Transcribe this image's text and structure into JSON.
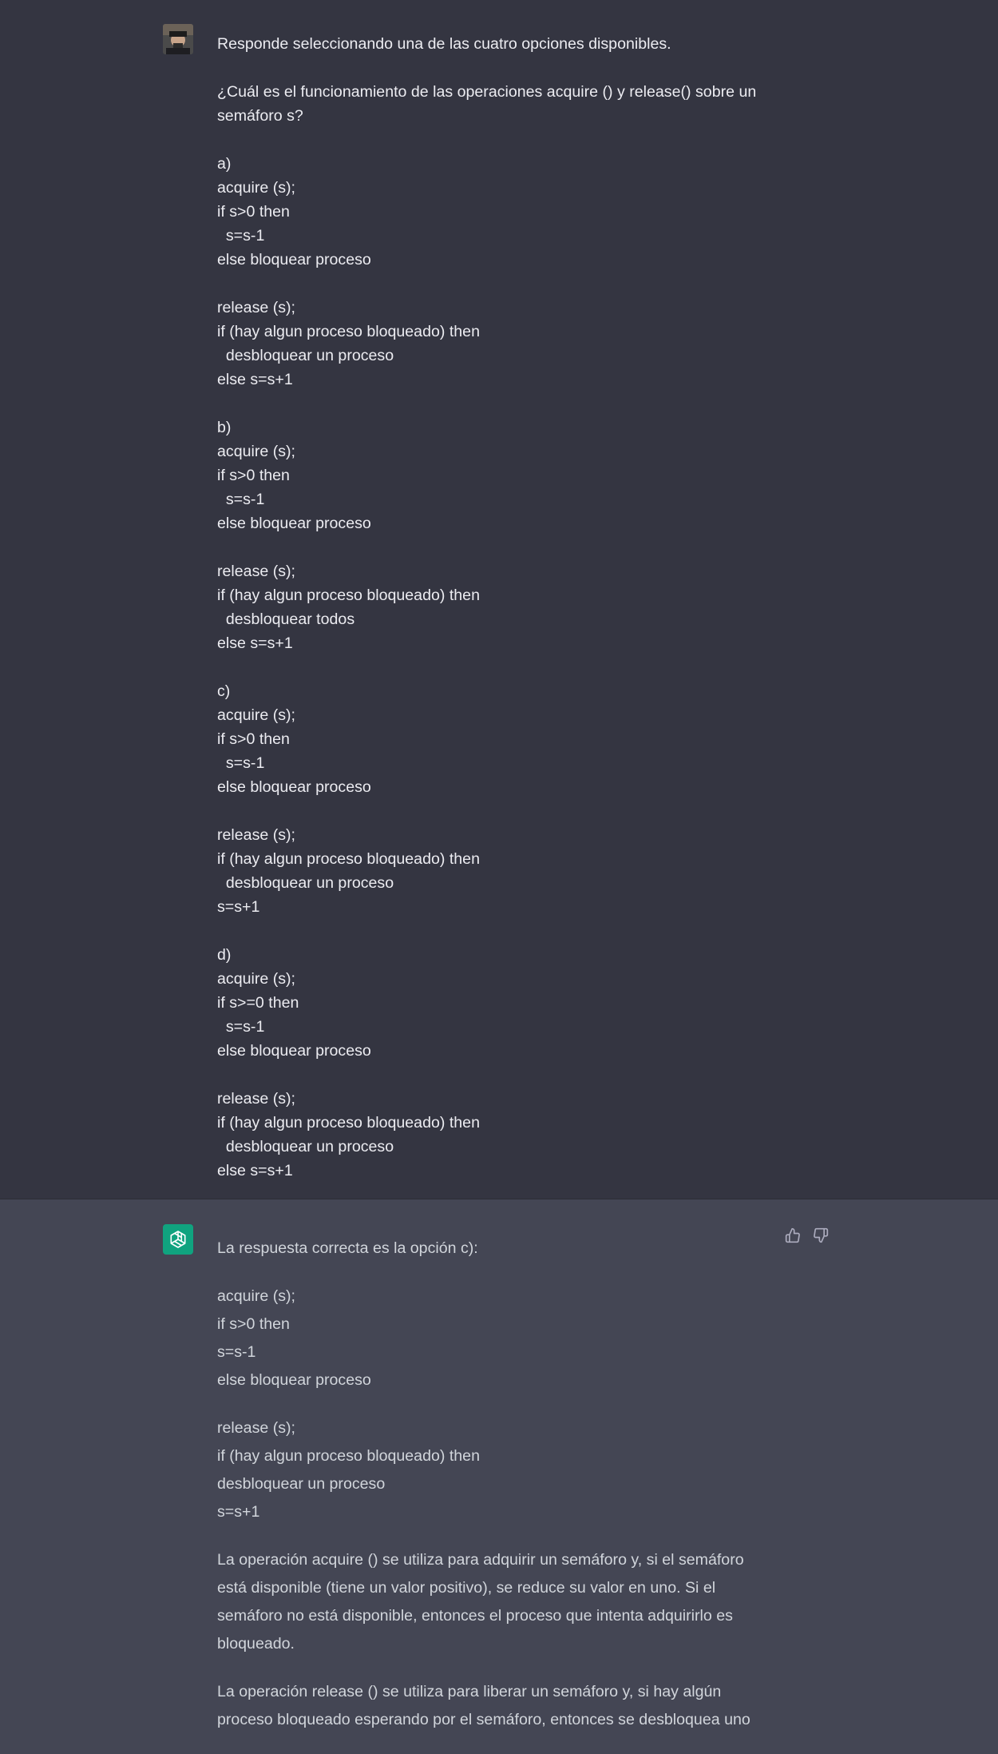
{
  "user_message": {
    "intro": "Responde seleccionando una de las cuatro opciones disponibles.",
    "question": "¿Cuál es el funcionamiento de las operaciones acquire () y release() sobre un semáforo s?",
    "options": [
      {
        "label": "a)",
        "lines": [
          "acquire (s);",
          "if s>0 then",
          "  s=s-1",
          "else bloquear proceso",
          "",
          "release (s);",
          "if (hay algun proceso bloqueado) then",
          "  desbloquear un proceso",
          "else s=s+1"
        ]
      },
      {
        "label": "b)",
        "lines": [
          "acquire (s);",
          "if s>0 then",
          "  s=s-1",
          "else bloquear proceso",
          "",
          "release (s);",
          "if (hay algun proceso bloqueado) then",
          "  desbloquear todos",
          "else s=s+1"
        ]
      },
      {
        "label": "c)",
        "lines": [
          "acquire (s);",
          "if s>0 then",
          "  s=s-1",
          "else bloquear proceso",
          "",
          "release (s);",
          "if (hay algun proceso bloqueado) then",
          "  desbloquear un proceso",
          "s=s+1"
        ]
      },
      {
        "label": "d)",
        "lines": [
          "acquire (s);",
          "if s>=0 then",
          "  s=s-1",
          "else bloquear proceso",
          "",
          "release (s);",
          "if (hay algun proceso bloqueado) then",
          "  desbloquear un proceso",
          "else s=s+1"
        ]
      }
    ]
  },
  "assistant_message": {
    "answer_intro": "La respuesta correcta es la opción c):",
    "code_block_1": [
      "acquire (s);",
      "if s>0 then",
      "s=s-1",
      "else bloquear proceso"
    ],
    "code_block_2": [
      "release (s);",
      "if (hay algun proceso bloqueado) then",
      "desbloquear un proceso",
      "s=s+1"
    ],
    "explanation_1": "La operación acquire () se utiliza para adquirir un semáforo y, si el semáforo está disponible (tiene un valor positivo), se reduce su valor en uno. Si el semáforo no está disponible, entonces el proceso que intenta adquirirlo es bloqueado.",
    "explanation_2": "La operación release () se utiliza para liberar un semáforo y, si hay algún proceso bloqueado esperando por el semáforo, entonces se desbloquea uno"
  },
  "icons": {
    "user_avatar": "user-avatar",
    "bot_avatar": "openai-logo-icon",
    "thumbs_up": "thumbs-up-icon",
    "thumbs_down": "thumbs-down-icon"
  },
  "colors": {
    "user_bg": "#343541",
    "assistant_bg": "#444654",
    "bot_avatar_bg": "#10a37f",
    "user_text": "#ececf1",
    "assistant_text": "#d1d5db"
  }
}
